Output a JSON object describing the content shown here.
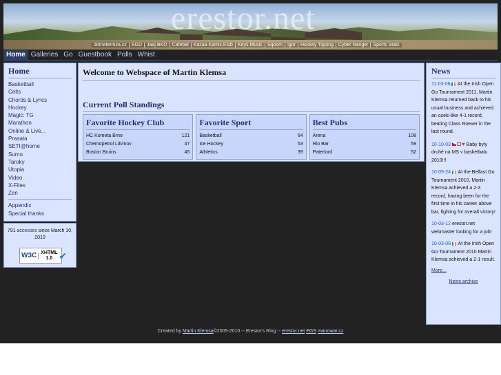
{
  "site": {
    "title": "erestor.net"
  },
  "banner_links": [
    "dotnetermza.cz",
    "EGD",
    "Jaaj BKO",
    "Cafebal",
    "Kazaa Kamix Klub",
    "Keys Music",
    "Sqoom",
    "Igor",
    "Hockey Tipping",
    "Cyber Ranger",
    "Sports Stats"
  ],
  "topnav": [
    "Home",
    "Galleries",
    "Go",
    "Guestbook",
    "Polls",
    "Whist"
  ],
  "sidebar": {
    "title": "Home",
    "items": [
      "Basketball",
      "Celts",
      "Chords & Lyrics",
      "Hockey",
      "Magic: TG",
      "Marathon",
      "Online & Live...",
      "Prasata",
      "SETI@home",
      "Sumo",
      "Taroky",
      "Utopia",
      "Video",
      "X-Files",
      "Zen"
    ],
    "extra": [
      "Appendix",
      "Special thanks"
    ]
  },
  "counter": {
    "count": "791",
    "link": "accesses",
    "suffix": "since March 10, 2010"
  },
  "w3c": {
    "w": "W3C",
    "xhtml": "XHTML",
    "version": "1.0"
  },
  "main": {
    "welcome": "Welcome to Webspace of Martin Klemsa",
    "poll_heading": "Current Poll Standings"
  },
  "polls": [
    {
      "title": "Favorite Hockey Club",
      "rows": [
        [
          "HC Kometa Brno",
          "121"
        ],
        [
          "Chemopetrol Litvinov",
          "47"
        ],
        [
          "Boston Bruins",
          "45"
        ]
      ]
    },
    {
      "title": "Favorite Sport",
      "rows": [
        [
          "Basketball",
          "64"
        ],
        [
          "Ice Hockey",
          "53"
        ],
        [
          "Athletics",
          "39"
        ]
      ]
    },
    {
      "title": "Best Pubs",
      "rows": [
        [
          "Arena",
          "108"
        ],
        [
          "Rio Bar",
          "59"
        ],
        [
          "Paterlord",
          "52"
        ]
      ]
    }
  ],
  "news": {
    "title": "News",
    "items": [
      {
        "date": "11-03-06",
        "text": "At the Irish Open Go Tournament 2011, Martin Klemsa returned back to his usual business and achieved an ozeki-like 4-1 record, beating Class Roever in the last round."
      },
      {
        "date": "10-10-03",
        "text": "Baby byly druhé na MS v basketbalu 2010!!!"
      },
      {
        "date": "10-09-24",
        "text": "At the Belfast Go Tournament 2010, Martin Klemsa achieved a 2-3 record, having been for the first time in his career above bar, fighting for overall victory!"
      },
      {
        "date": "10-03-12",
        "text": "erestor.net webmaster looking for a job!"
      },
      {
        "date": "10-03-09",
        "text": "At the Irish Open Go Tournament 2010 Martin Klemsa achieved a 2-1 result."
      }
    ],
    "more": "More...",
    "archive": "News archive"
  },
  "footer": {
    "created": "Created by",
    "author": "Martin Klemsa",
    "years": "©2005-2010",
    "ring": "-- Erestor's Ring --",
    "links": [
      "erestor.net",
      "EGS",
      "manowar.cz"
    ]
  }
}
